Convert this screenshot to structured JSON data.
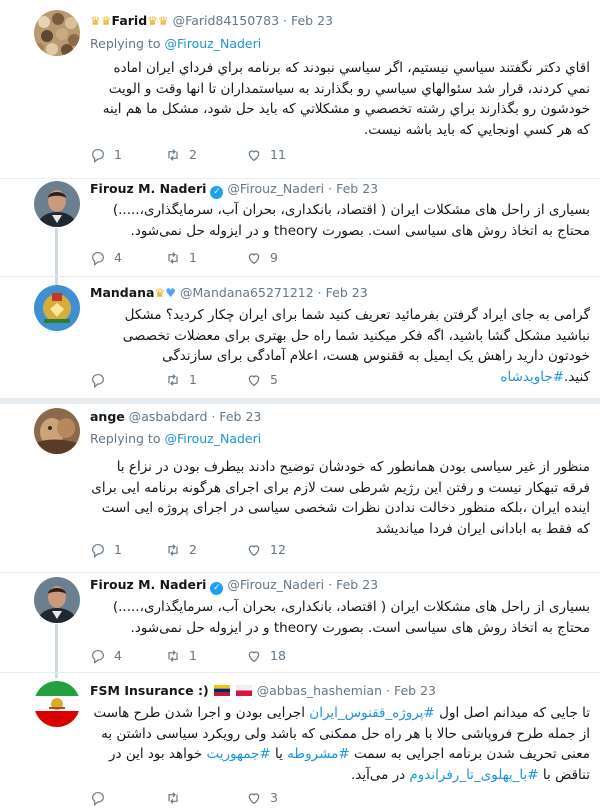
{
  "tweets": [
    {
      "name": "Farid",
      "handle": "@Farid84150783",
      "time": "Feb 23",
      "replying_label": "Replying to",
      "replying_to": "@Firouz_Naderi",
      "text": "اقاي دكتر  نگفتند سياسي نيستيم، اگر سياسي نبودند كه برنامه براي فرداي ايران اماده نمي كردند، قرار شد سئوالهاي سياسي رو بگذارند به سياستمداران تا انها وقت و الويت خودشون رو بگذارند براي رشته تخصصي و مشكلاتي كه بايد حل شود، مشكل ما هم اينه كه هر كسي اونجايي كه بايد باشه نيست.",
      "replies": "1",
      "retweets": "2",
      "likes": "11"
    },
    {
      "name": "Firouz M. Naderi",
      "handle": "@Firouz_Naderi",
      "time": "Feb 23",
      "text": "بسیاری از راحل های مشکلات ایران ( اقتصاد، بانکداری، بحران آب، سرمایگذاری،.....) محتاج به اتخاذ روش های سیاسی است. بصورت theory و در ایزوله حل نمی‌شود.",
      "replies": "4",
      "retweets": "1",
      "likes": "9"
    },
    {
      "name": "Mandana",
      "handle": "@Mandana65271212",
      "time": "Feb 23",
      "text_plain": "گرامی به جای ایراد گرفتن بفرمائید تعریف کنید شما برای ایران چکار کردید؟ مشکل نباشید مشکل گشا باشید، اگه فکر میکنید شما راه حل بهتری برای معضلات تخصصی خودتون دارید راهش یک ایمیل به ققنوس هست، اعلام آمادگی برای سازندگی کنید.",
      "hashtag": "#جاویدشاه",
      "replies": "",
      "retweets": "1",
      "likes": "5"
    },
    {
      "name": "ange",
      "handle": "@asbabdard",
      "time": "Feb 23",
      "replying_label": "Replying to",
      "replying_to": "@Firouz_Naderi",
      "text": "منظور از غیر سیاسی بودن همانطور که خودشان توضیح دادند بیطرف بودن در نزاع با فرقه تبهکار نیست و رفتن این رژیم شرطی ست لازم برای اجرای هرگونه برنامه ایی  برای اینده ایران ،بلکه  منظور دخالت ندادن نظرات شخصی سیاسی در اجرای پروژه ایی است که فقط به ابادانی ایران فردا میاندیشد",
      "replies": "1",
      "retweets": "2",
      "likes": "12"
    },
    {
      "name": "Firouz M. Naderi",
      "handle": "@Firouz_Naderi",
      "time": "Feb 23",
      "text": "بسیاری از راحل های مشکلات ایران ( اقتصاد، بانکداری، بحران آب، سرمایگذاری،.....) محتاج به اتخاذ روش های سیاسی است. بصورت theory و در ایزوله حل نمی‌شود.",
      "replies": "4",
      "retweets": "1",
      "likes": "18"
    },
    {
      "name": "FSM Insurance :)",
      "handle": "@abbas_hashemian",
      "time": "Feb 23",
      "text_a": "تا جایی که میدانم اصل اول ",
      "tag_a": "#پروژه_ققنوس_ایران",
      "text_b": " اجرایی بودن و اجرا شدن طرح هاست از جمله طرح فروپاشی حالا با هر راه حل ممکنی که باشد ولی رویکرد سیاسی داشتن به معنی تحریف شدن برنامه اجرایی به سمت ",
      "tag_b": "#مشروطه",
      "text_c": " یا ",
      "tag_c": "#جمهوریت",
      "text_d": " خواهد بود این در تناقض با ",
      "tag_d": "#با_پهلوی_تا_رفراندوم",
      "text_e": " در می‌آید.",
      "replies": "",
      "retweets": "",
      "likes": "3"
    }
  ],
  "colors": {
    "link": "#1b95e0",
    "muted": "#657786",
    "divider": "#e6ecf0",
    "verified": "#1da1f2"
  },
  "icons": [
    "reply-icon",
    "retweet-icon",
    "like-icon",
    "verified-badge-icon",
    "crown-icon",
    "blue-heart-icon",
    "venezuela-flag-icon",
    "poland-flag-icon"
  ]
}
